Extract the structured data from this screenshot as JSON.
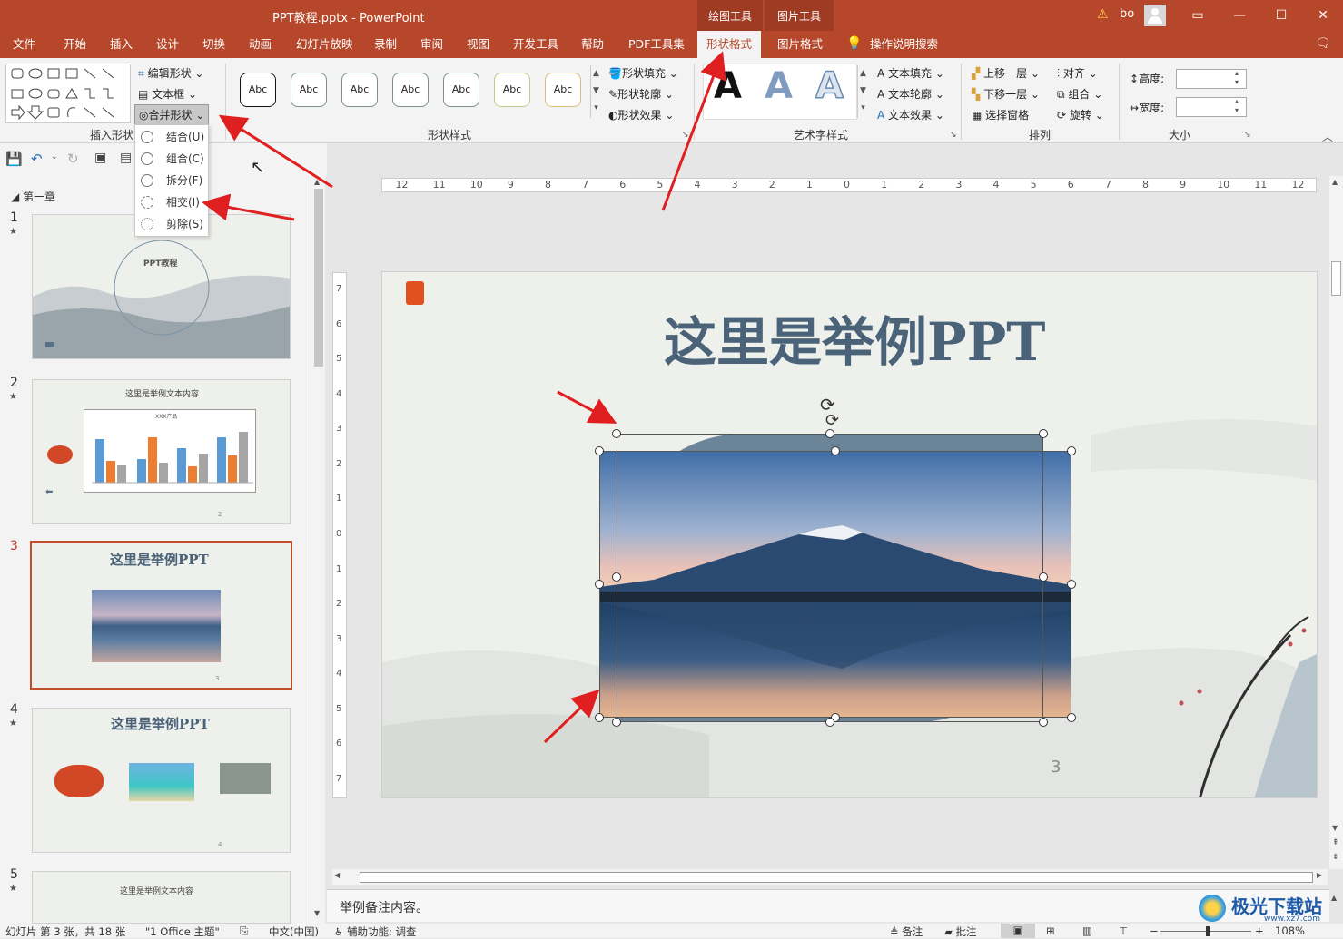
{
  "titlebar": {
    "title": "PPT教程.pptx - PowerPoint",
    "context_tabs": [
      "绘图工具",
      "图片工具"
    ],
    "user": "bo",
    "warning_icon": "warning-icon"
  },
  "menu": {
    "tabs": [
      "文件",
      "开始",
      "插入",
      "设计",
      "切换",
      "动画",
      "幻灯片放映",
      "录制",
      "审阅",
      "视图",
      "开发工具",
      "帮助",
      "PDF工具集",
      "形状格式",
      "图片格式"
    ],
    "active_tab": "形状格式",
    "tell_me": "操作说明搜索"
  },
  "ribbon": {
    "insert_shapes": {
      "label": "插入形状",
      "edit_shape": "编辑形状",
      "text_box": "文本框",
      "merge_shapes": "合并形状"
    },
    "shape_styles": {
      "label": "形状样式",
      "samples": [
        "Abc",
        "Abc",
        "Abc",
        "Abc",
        "Abc",
        "Abc",
        "Abc"
      ],
      "fill": "形状填充",
      "outline": "形状轮廓",
      "effects": "形状效果"
    },
    "wordart": {
      "label": "艺术字样式",
      "sample": "A",
      "text_fill": "文本填充",
      "text_outline": "文本轮廓",
      "text_effects": "文本效果"
    },
    "arrange": {
      "label": "排列",
      "bring_forward": "上移一层",
      "send_backward": "下移一层",
      "selection_pane": "选择窗格",
      "align": "对齐",
      "group": "组合",
      "rotate": "旋转"
    },
    "size": {
      "label": "大小",
      "height_label": "高度:",
      "width_label": "宽度:",
      "height_value": "",
      "width_value": ""
    }
  },
  "merge_menu": {
    "items": [
      "结合(U)",
      "组合(C)",
      "拆分(F)",
      "相交(I)",
      "剪除(S)"
    ]
  },
  "outline": {
    "section": "第一章",
    "slides": [
      {
        "num": "1",
        "title": "PPT教程"
      },
      {
        "num": "2",
        "title": "这里是举例文本内容"
      },
      {
        "num": "3",
        "title": "这里是举例PPT"
      },
      {
        "num": "4",
        "title": "这里是举例PPT"
      },
      {
        "num": "5",
        "title": "这里是举例文本内容"
      }
    ],
    "slide2_chart_title": "XXX产品",
    "slide2_page": "2",
    "slide3_page": "3",
    "slide4_page": "4"
  },
  "ruler": {
    "h_ticks": [
      "12",
      "11",
      "10",
      "9",
      "8",
      "7",
      "6",
      "5",
      "4",
      "3",
      "2",
      "1",
      "0",
      "1",
      "2",
      "3",
      "4",
      "5",
      "6",
      "7",
      "8",
      "9",
      "10",
      "11",
      "12"
    ],
    "v_ticks": [
      "7",
      "6",
      "5",
      "4",
      "3",
      "2",
      "1",
      "0",
      "1",
      "2",
      "3",
      "4",
      "5",
      "6",
      "7"
    ]
  },
  "slide": {
    "title": "这里是举例PPT",
    "page_number": "3"
  },
  "notes": {
    "text": "举例备注内容。"
  },
  "status": {
    "slide_info": "幻灯片 第 3 张，共 18 张",
    "theme": "\"1 Office 主题\"",
    "language": "中文(中国)",
    "accessibility": "辅助功能: 调查",
    "notes_btn": "备注",
    "comments_btn": "批注",
    "zoom": "108%"
  },
  "watermark": "极光下载站",
  "watermark_url": "www.xz7.com",
  "colors": {
    "accent": "#b7472a",
    "title_text": "#4a6378",
    "arrow": "#e02020"
  }
}
